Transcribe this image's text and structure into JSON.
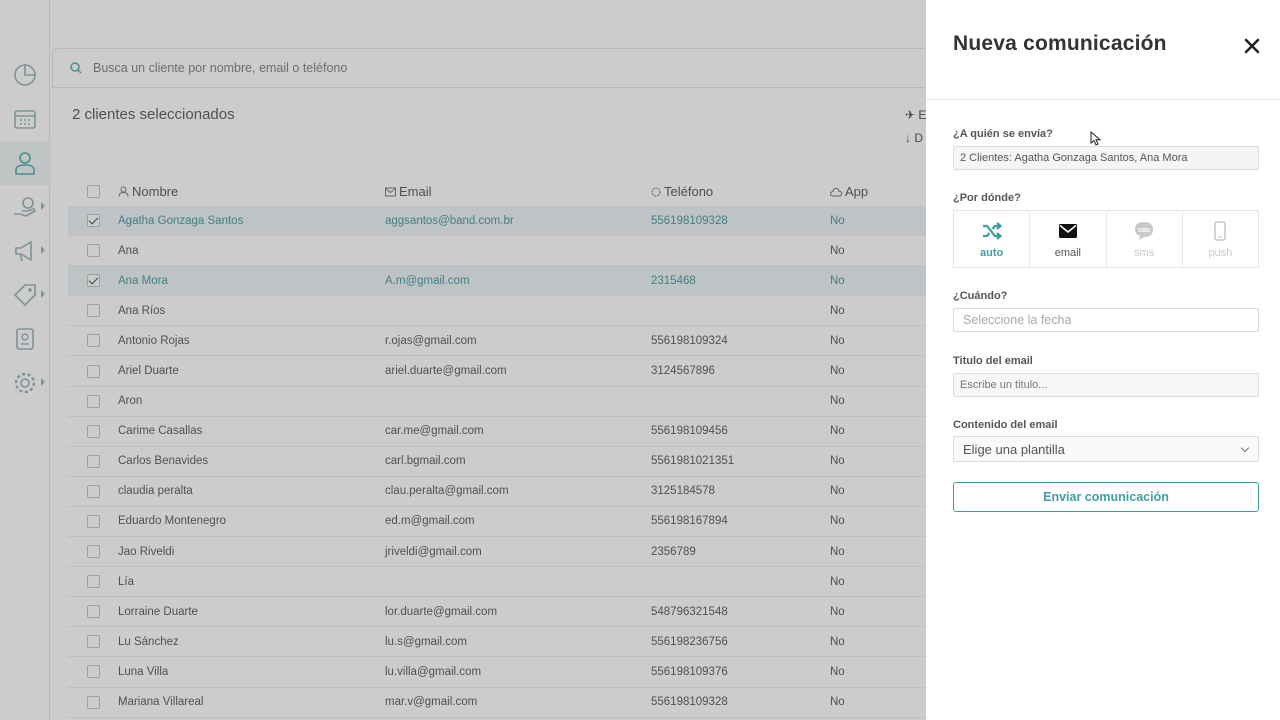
{
  "search": {
    "placeholder": "Busca un cliente por nombre, email o teléfono"
  },
  "selection": {
    "title": "2 clientes seleccionados",
    "action_send": "E",
    "action_download": "D"
  },
  "table": {
    "headers": {
      "name": "Nombre",
      "email": "Email",
      "phone": "Teléfono",
      "app": "App"
    },
    "rows": [
      {
        "selected": true,
        "name": "Agatha Gonzaga Santos",
        "email": "aggsantos@band.com.br",
        "phone": "556198109328",
        "app": "No"
      },
      {
        "selected": false,
        "name": "Ana",
        "email": "",
        "phone": "",
        "app": "No"
      },
      {
        "selected": true,
        "name": "Ana Mora",
        "email": "A.m@gmail.com",
        "phone": "2315468",
        "app": "No"
      },
      {
        "selected": false,
        "name": "Ana Ríos",
        "email": "",
        "phone": "",
        "app": "No"
      },
      {
        "selected": false,
        "name": "Antonio Rojas",
        "email": "r.ojas@gmail.com",
        "phone": "556198109324",
        "app": "No"
      },
      {
        "selected": false,
        "name": "Ariel Duarte",
        "email": "ariel.duarte@gmail.com",
        "phone": "3124567896",
        "app": "No"
      },
      {
        "selected": false,
        "name": "Aron",
        "email": "",
        "phone": "",
        "app": "No"
      },
      {
        "selected": false,
        "name": "Carime Casallas",
        "email": "car.me@gmail.com",
        "phone": "556198109456",
        "app": "No"
      },
      {
        "selected": false,
        "name": "Carlos Benavides",
        "email": "carl.bgmail.com",
        "phone": "5561981021351",
        "app": "No"
      },
      {
        "selected": false,
        "name": "claudia peralta",
        "email": "clau.peralta@gmail.com",
        "phone": "3125184578",
        "app": "No"
      },
      {
        "selected": false,
        "name": "Eduardo Montenegro",
        "email": "ed.m@gmail.com",
        "phone": "556198167894",
        "app": "No"
      },
      {
        "selected": false,
        "name": "Jao Riveldi",
        "email": "jriveldi@gmail.com",
        "phone": "2356789",
        "app": "No"
      },
      {
        "selected": false,
        "name": "Lía",
        "email": "",
        "phone": "",
        "app": "No"
      },
      {
        "selected": false,
        "name": "Lorraine Duarte",
        "email": "lor.duarte@gmail.com",
        "phone": "548796321548",
        "app": "No"
      },
      {
        "selected": false,
        "name": "Lu Sánchez",
        "email": "lu.s@gmail.com",
        "phone": "556198236756",
        "app": "No"
      },
      {
        "selected": false,
        "name": "Luna Villa",
        "email": "lu.villa@gmail.com",
        "phone": "556198109376",
        "app": "No"
      },
      {
        "selected": false,
        "name": "Mariana Villareal",
        "email": "mar.v@gmail.com",
        "phone": "556198109328",
        "app": "No"
      }
    ]
  },
  "drawer": {
    "title": "Nueva comunicación",
    "to_label": "¿A quién se envía?",
    "to_value": "2 Clientes: Agatha Gonzaga Santos, Ana Mora",
    "channel_label": "¿Por dónde?",
    "channels": [
      {
        "id": "auto",
        "label": "auto",
        "icon": "shuffle-icon"
      },
      {
        "id": "email",
        "label": "email",
        "icon": "envelope-icon"
      },
      {
        "id": "sms",
        "label": "sms",
        "icon": "sms-bubble-icon"
      },
      {
        "id": "push",
        "label": "push",
        "icon": "mobile-phone-icon"
      }
    ],
    "when_label": "¿Cuándo?",
    "when_placeholder": "Seleccione la fecha",
    "subject_label": "Titulo del email",
    "subject_placeholder": "Escribe un titulo...",
    "content_label": "Contenido del email",
    "content_value": "Elige una plantilla",
    "send_label": "Enviar comunicación"
  },
  "colors": {
    "accent": "#3f9ea4",
    "overlay": "#696969"
  }
}
